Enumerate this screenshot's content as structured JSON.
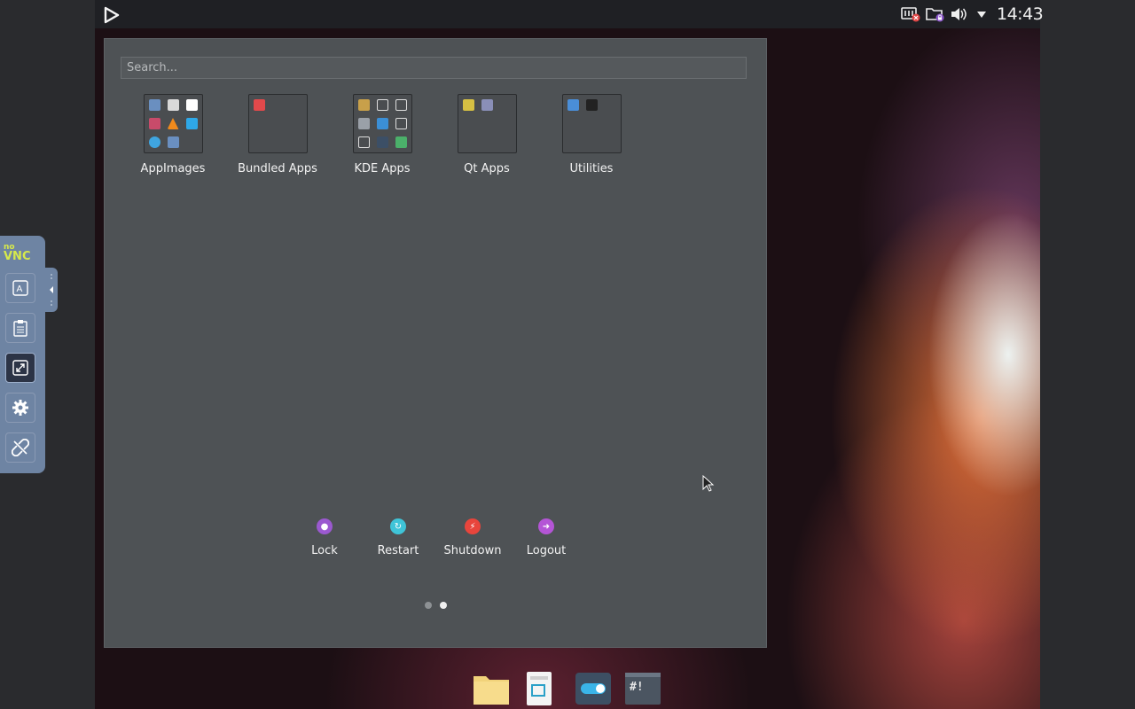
{
  "topbar": {
    "clock": "14:43",
    "tray_icons": [
      "network-disconnected-icon",
      "folder-lock-icon",
      "volume-icon",
      "dropdown-arrow-icon"
    ]
  },
  "launcher": {
    "search_placeholder": "Search...",
    "folders": [
      {
        "label": "AppImages"
      },
      {
        "label": "Bundled Apps"
      },
      {
        "label": "KDE Apps"
      },
      {
        "label": "Qt Apps"
      },
      {
        "label": "Utilities"
      }
    ],
    "power": [
      {
        "label": "Lock",
        "color": "#9b59d0",
        "icon": "lock-icon"
      },
      {
        "label": "Restart",
        "color": "#3fc4d8",
        "icon": "restart-icon"
      },
      {
        "label": "Shutdown",
        "color": "#e8453c",
        "icon": "shutdown-icon"
      },
      {
        "label": "Logout",
        "color": "#b455d6",
        "icon": "logout-icon"
      }
    ],
    "page_count": 2,
    "current_page": 2
  },
  "dock": {
    "items": [
      "file-manager-icon",
      "screenshot-icon",
      "settings-toggle-icon",
      "terminal-icon"
    ]
  },
  "novnc": {
    "logo_top": "no",
    "logo_bottom": "VNC",
    "buttons": [
      "keyboard-icon",
      "clipboard-icon",
      "fullscreen-icon",
      "settings-gear-icon",
      "disconnect-icon"
    ]
  }
}
